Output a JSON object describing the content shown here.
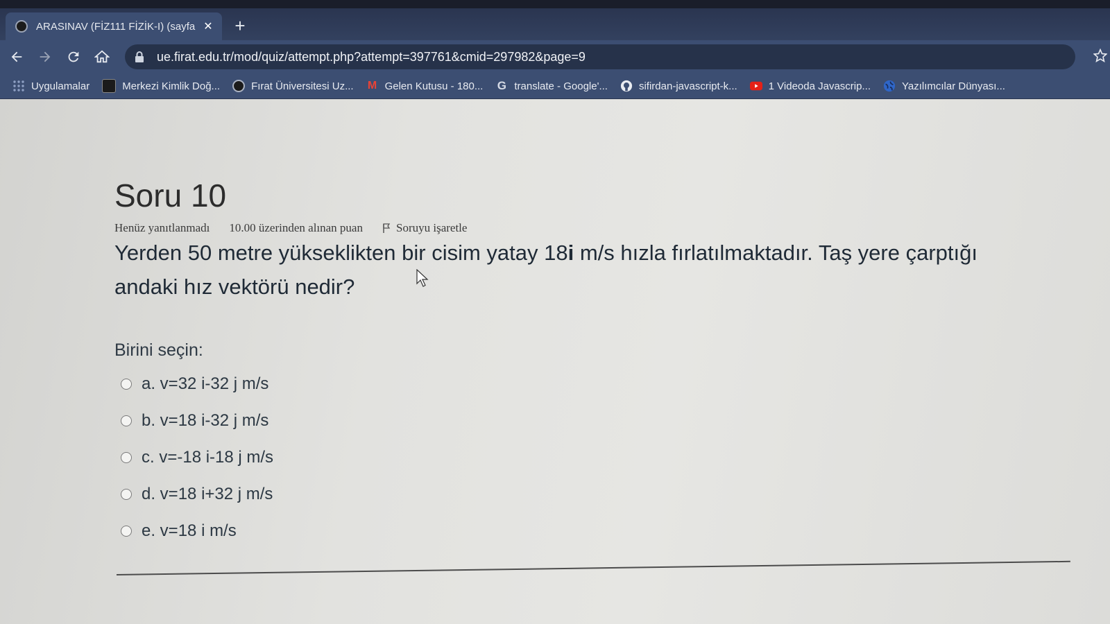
{
  "browser": {
    "tab": {
      "title": "ARASINAV (FİZ111 FİZİK-I) (sayfa"
    },
    "address_bar": {
      "url": "ue.firat.edu.tr/mod/quiz/attempt.php?attempt=397761&cmid=297982&page=9"
    },
    "bookmarks": [
      {
        "label": "Uygulamalar",
        "icon": "apps-grid-icon"
      },
      {
        "label": "Merkezi Kimlik Doğ...",
        "icon": "id-card-icon"
      },
      {
        "label": "Fırat Üniversitesi Uz...",
        "icon": "university-logo-icon"
      },
      {
        "label": "Gelen Kutusu - 180...",
        "icon": "gmail-icon"
      },
      {
        "label": "translate - Google'...",
        "icon": "google-icon"
      },
      {
        "label": "sifirdan-javascript-k...",
        "icon": "github-icon"
      },
      {
        "label": "1 Videoda Javascrip...",
        "icon": "youtube-icon"
      },
      {
        "label": "Yazılımcılar Dünyası...",
        "icon": "globe-icon"
      }
    ]
  },
  "question": {
    "heading": "Soru 10",
    "status": "Henüz yanıtlanmadı",
    "grade": "10.00 üzerinden alınan puan",
    "flag_label": "Soruyu işaretle",
    "text_part1": "Yerden 50 metre yükseklikten bir cisim yatay 18",
    "text_bold": "i",
    "text_part2": " m/s hızla fırlatılmaktadır. Taş yere çarptığı andaki hız vektörü nedir?",
    "prompt": "Birini seçin:",
    "options": [
      {
        "label": "a. v=32 i-32 j m/s"
      },
      {
        "label": "b. v=18 i-32 j m/s"
      },
      {
        "label": "c. v=-18 i-18 j m/s"
      },
      {
        "label": "d. v=18 i+32 j m/s"
      },
      {
        "label": "e. v=18 i m/s"
      }
    ]
  }
}
